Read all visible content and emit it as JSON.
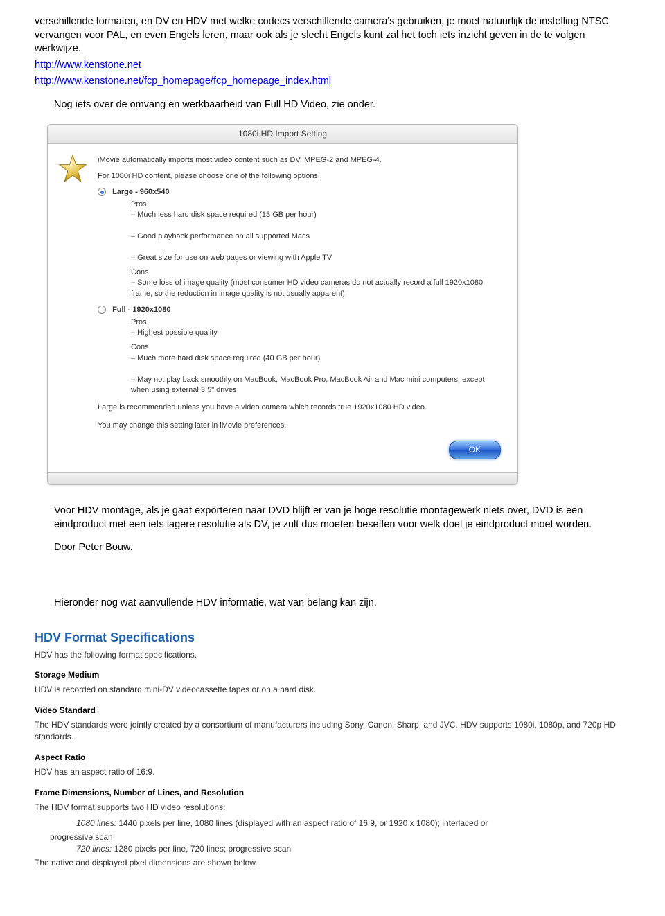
{
  "intro": {
    "para1": "verschillende formaten, en DV en HDV met welke codecs verschillende camera's gebruiken, je moet natuurlijk de instelling NTSC vervangen voor PAL, en even Engels leren, maar ook als je slecht Engels kunt zal het toch iets inzicht geven in de te volgen  werkwijze.",
    "link1": "http://www.kenstone.net",
    "link2": "http://www.kenstone.net/fcp_homepage/fcp_homepage_index.html",
    "indented1": "Nog iets over de omvang en werkbaarheid van Full HD Video, zie onder."
  },
  "dialog": {
    "title": "1080i HD Import Setting",
    "lead1": "iMovie automatically imports most video content such as DV, MPEG-2 and MPEG-4.",
    "lead2": "For 1080i HD content, please choose one of the following options:",
    "opt1": {
      "label": "Large - 960x540",
      "pros1": "– Much less hard disk space required (13 GB per hour)",
      "pros2": "– Good playback performance on all supported Macs",
      "pros3": "– Great size for use on web pages or viewing with Apple TV",
      "cons1": "– Some loss of image quality (most consumer HD video cameras do not actually record a full 1920x1080 frame, so the reduction in image quality is not usually apparent)"
    },
    "opt2": {
      "label": "Full - 1920x1080",
      "pros1": "– Highest possible quality",
      "cons1": "– Much more hard disk space required (40 GB per hour)",
      "cons2": "– May not play back smoothly on MacBook, MacBook Pro, MacBook Air and Mac mini computers, except when using external 3.5\" drives"
    },
    "rec1": "Large is recommended unless you have a video camera which records true 1920x1080 HD video.",
    "rec2": "You may change this setting later in iMovie preferences.",
    "ok": "OK",
    "proslbl": "Pros",
    "conslbl": "Cons"
  },
  "after": {
    "para1": "Voor HDV montage, als je gaat exporteren naar DVD blijft er van je hoge resolutie montagewerk niets over, DVD is een eindproduct met een iets lagere resolutie als DV, je zult dus moeten beseffen voor welk doel je eindproduct moet worden.",
    "author": "Door Peter Bouw.",
    "para2": "Hieronder nog wat aanvullende HDV informatie, wat van belang kan zijn."
  },
  "specs": {
    "heading": "HDV Format Specifications",
    "intro": "HDV has the following format specifications.",
    "storage_t": "Storage Medium",
    "storage": "HDV is recorded on standard mini-DV videocassette tapes or on a hard disk.",
    "video_t": "Video Standard",
    "video": "The HDV standards were jointly created by a consortium of manufacturers including Sony, Canon, Sharp, and JVC. HDV supports 1080i, 1080p, and 720p HD standards.",
    "aspect_t": "Aspect Ratio",
    "aspect": "HDV has an aspect ratio of 16:9.",
    "frame_t": "Frame Dimensions, Number of Lines, and Resolution",
    "frame_intro": "The HDV format supports two HD video resolutions:",
    "res1_lead": "1080 lines:",
    "res1": " 1440 pixels per line, 1080 lines (displayed with an aspect ratio of 16:9, or 1920 x 1080); interlaced or progressive scan",
    "res2_lead": "720 lines:",
    "res2": " 1280 pixels per line, 720 lines; progressive scan",
    "footer": "The native and displayed pixel dimensions are shown below."
  }
}
